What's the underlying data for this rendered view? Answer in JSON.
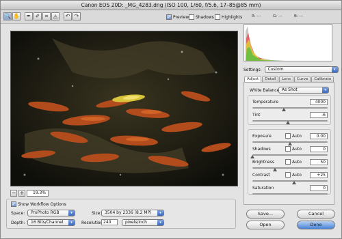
{
  "window": {
    "title": "Canon EOS 20D: _MG_4283.dng  (ISO 100, 1/60, f/5.6, 17–85@85 mm)"
  },
  "toolbar": {
    "tools": [
      {
        "name": "zoom-tool-icon",
        "glyph": "🔍"
      },
      {
        "name": "hand-tool-icon",
        "glyph": "✋"
      },
      {
        "name": "white-balance-tool-icon",
        "glyph": "✒"
      },
      {
        "name": "color-sampler-tool-icon",
        "glyph": "✐"
      },
      {
        "name": "crop-tool-icon",
        "glyph": "⌗"
      },
      {
        "name": "straighten-tool-icon",
        "glyph": "◬"
      },
      {
        "name": "rotate-left-icon",
        "glyph": "↶"
      },
      {
        "name": "rotate-right-icon",
        "glyph": "↷"
      }
    ],
    "preview_label": "Preview",
    "shadows_label": "Shadows",
    "highlights_label": "Highlights",
    "rgb_readout": {
      "r": "R: ---",
      "g": "G: ---",
      "b": "B: ---"
    }
  },
  "zoom": {
    "minus": "−",
    "plus": "+",
    "value": "19.3%"
  },
  "settings": {
    "label": "Settings:",
    "value": "Custom"
  },
  "tabs": [
    "Adjust",
    "Detail",
    "Lens",
    "Curve",
    "Calibrate"
  ],
  "white_balance": {
    "label": "White Balance:",
    "value": "As Shot"
  },
  "sliders": {
    "temperature": {
      "label": "Temperature",
      "value": "4000",
      "level": 0.42
    },
    "tint": {
      "label": "Tint",
      "value": "-6",
      "level": 0.47
    },
    "exposure": {
      "label": "Exposure",
      "auto": "Auto",
      "value": "0.00",
      "level": 0.5
    },
    "shadows": {
      "label": "Shadows",
      "auto": "Auto",
      "value": "0",
      "level": 0.0
    },
    "brightness": {
      "label": "Brightness",
      "auto": "Auto",
      "value": "50",
      "level": 0.3
    },
    "contrast": {
      "label": "Contrast",
      "auto": "Auto",
      "value": "+25",
      "level": 0.55
    },
    "saturation": {
      "label": "Saturation",
      "value": "0",
      "level": 0.5
    }
  },
  "workflow": {
    "toggle_label": "Show Workflow Options",
    "space_label": "Space:",
    "space_value": "ProPhoto RGB",
    "size_label": "Size:",
    "size_value": "3504 by 2336 (8.2 MP)",
    "depth_label": "Depth:",
    "depth_value": "16 Bits/Channel",
    "resolution_label": "Resolution:",
    "resolution_value": "240",
    "resolution_unit": "pixels/inch"
  },
  "buttons": {
    "save": "Save...",
    "cancel": "Cancel",
    "open": "Open",
    "done": "Done"
  },
  "colors": {
    "accent": "#3c69c3",
    "fish": "#c2521e",
    "background": "#1b1a12"
  }
}
